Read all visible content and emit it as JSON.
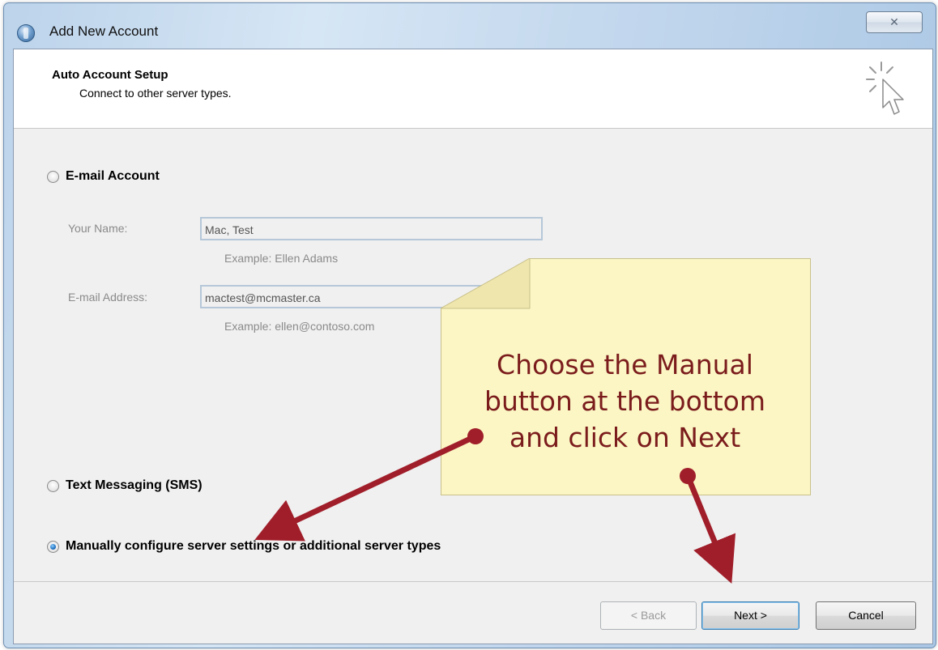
{
  "window": {
    "title": "Add New Account",
    "close_glyph": "✕"
  },
  "header": {
    "title": "Auto Account Setup",
    "subtitle": "Connect to other server types."
  },
  "options": {
    "email_account": {
      "label": "E-mail Account",
      "checked": false
    },
    "sms": {
      "label": "Text Messaging (SMS)",
      "checked": false
    },
    "manual": {
      "label": "Manually configure server settings or additional server types",
      "checked": true
    }
  },
  "form": {
    "name_label": "Your Name:",
    "name_value": "Mac, Test",
    "name_example": "Example: Ellen Adams",
    "email_label": "E-mail Address:",
    "email_value": "mactest@mcmaster.ca",
    "email_example": "Example: ellen@contoso.com"
  },
  "buttons": {
    "back": "< Back",
    "next": "Next >",
    "cancel": "Cancel"
  },
  "callout": {
    "lines": [
      "Choose the Manual",
      "button at the bottom",
      "and click on Next"
    ]
  },
  "icons": {
    "app": "outlook-globe-icon",
    "wizard": "cursor-sparkle-icon",
    "close": "close-icon"
  },
  "colors": {
    "callout_text": "#7b1c1c",
    "callout_bg": "#fbf6c4",
    "arrow": "#a01e2a",
    "radio_checked": "#1f6fbf"
  }
}
